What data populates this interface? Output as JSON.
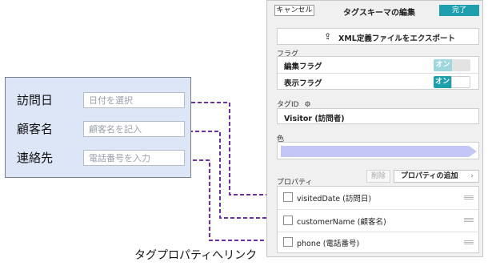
{
  "form": {
    "rows": [
      {
        "label": "訪問日",
        "placeholder": "日付を選択"
      },
      {
        "label": "顧客名",
        "placeholder": "顧客名を記入"
      },
      {
        "label": "連絡先",
        "placeholder": "電話番号を入力"
      }
    ]
  },
  "panel": {
    "cancel_label": "キャンセル",
    "title": "タグスキーマの編集",
    "done_label": "完了",
    "export_label": "XML定義ファイルをエクスポート",
    "flags_section": "フラグ",
    "edit_flag_label": "編集フラグ",
    "edit_flag_state": "オン",
    "display_flag_label": "表示フラグ",
    "display_flag_state": "オン",
    "tag_id_section": "タグID",
    "tag_id_value": "Visitor (訪問者)",
    "color_section": "色",
    "tag_color": "#c4c6f7",
    "properties_section": "プロパティ",
    "delete_label": "削除",
    "add_property_label": "プロパティの追加",
    "properties": [
      {
        "name": "visitedDate (訪問日)"
      },
      {
        "name": "customerName (顧客名)"
      },
      {
        "name": "phone (電話番号)"
      }
    ]
  },
  "caption": "タグプロパティへリンク",
  "colors": {
    "accent": "#1e9fae",
    "link_line": "#6b2fa6",
    "form_bg": "#dce6f7"
  }
}
